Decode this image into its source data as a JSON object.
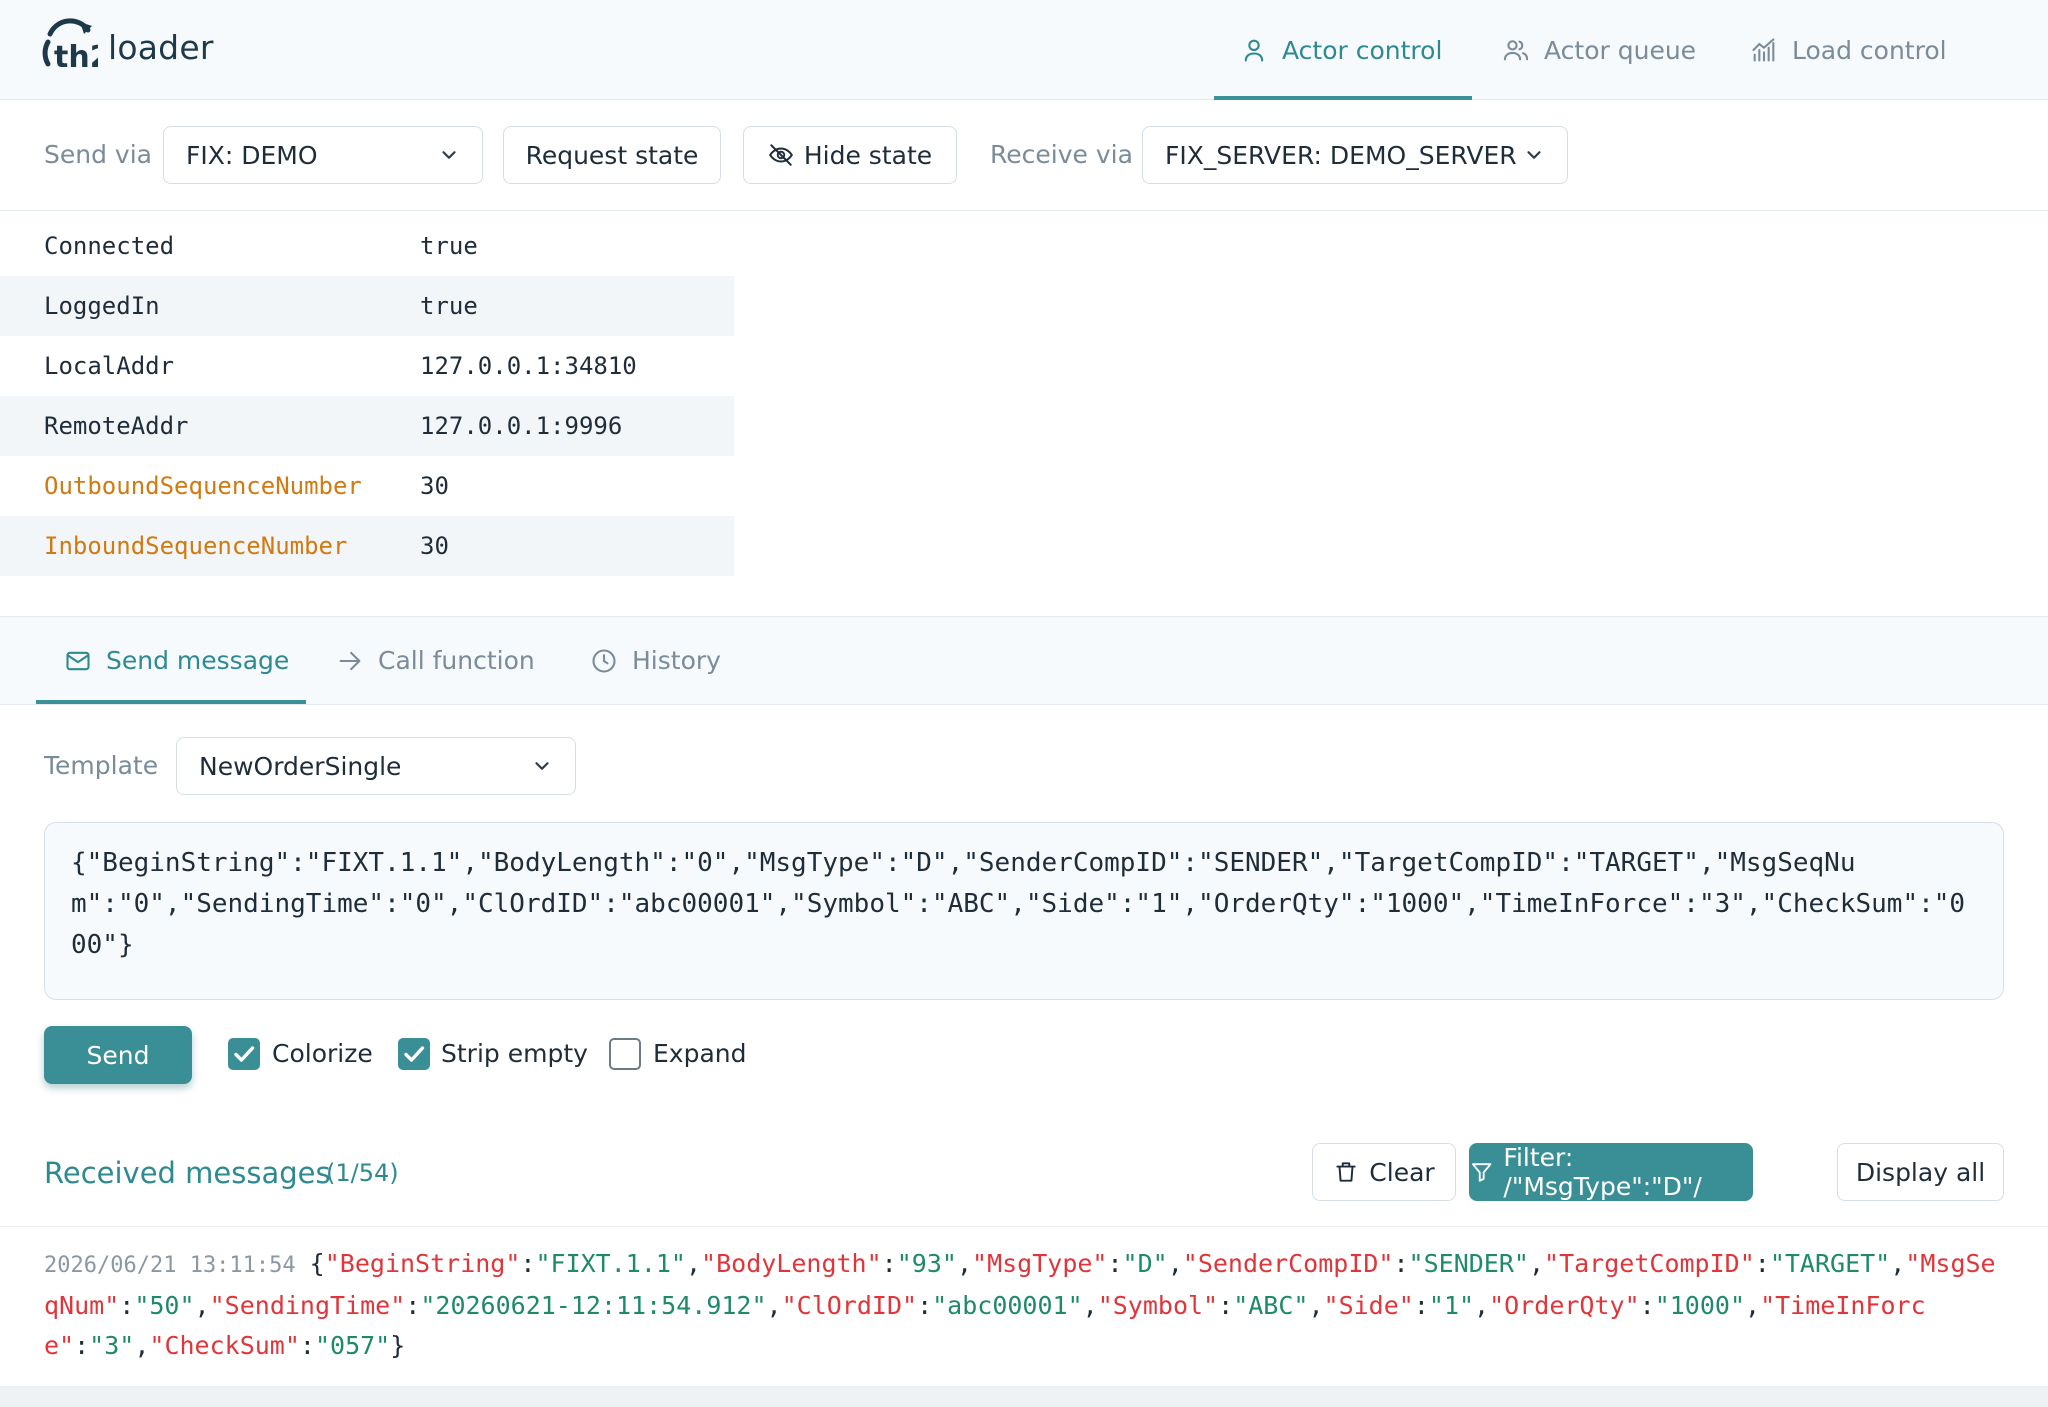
{
  "app": {
    "logo_text_bold": "th2",
    "logo_text": "loader"
  },
  "nav": [
    {
      "label": "Actor control",
      "icon": "user-icon",
      "active": true
    },
    {
      "label": "Actor queue",
      "icon": "users-icon",
      "active": false
    },
    {
      "label": "Load control",
      "icon": "chart-icon",
      "active": false
    }
  ],
  "toolbar": {
    "send_via_label": "Send via",
    "send_via_value": "FIX: DEMO",
    "request_state_label": "Request state",
    "hide_state_label": "Hide state",
    "receive_via_label": "Receive via",
    "receive_via_value": "FIX_SERVER: DEMO_SERVER"
  },
  "state": [
    {
      "key": "Connected",
      "value": "true",
      "highlight": false
    },
    {
      "key": "LoggedIn",
      "value": "true",
      "highlight": false
    },
    {
      "key": "LocalAddr",
      "value": "127.0.0.1:34810",
      "highlight": false
    },
    {
      "key": "RemoteAddr",
      "value": "127.0.0.1:9996",
      "highlight": false
    },
    {
      "key": "OutboundSequenceNumber",
      "value": "30",
      "highlight": true
    },
    {
      "key": "InboundSequenceNumber",
      "value": "30",
      "highlight": true
    }
  ],
  "tabs": [
    {
      "label": "Send message",
      "icon": "mail-icon",
      "active": true
    },
    {
      "label": "Call function",
      "icon": "arrow-right-icon",
      "active": false
    },
    {
      "label": "History",
      "icon": "clock-icon",
      "active": false
    }
  ],
  "template": {
    "label": "Template",
    "value": "NewOrderSingle",
    "body": "{\"BeginString\":\"FIXT.1.1\",\"BodyLength\":\"0\",\"MsgType\":\"D\",\"SenderCompID\":\"SENDER\",\"TargetCompID\":\"TARGET\",\"MsgSeqNum\":\"0\",\"SendingTime\":\"0\",\"ClOrdID\":\"abc00001\",\"Symbol\":\"ABC\",\"Side\":\"1\",\"OrderQty\":\"1000\",\"TimeInForce\":\"3\",\"CheckSum\":\"000\"}"
  },
  "send": {
    "button_label": "Send",
    "options": [
      {
        "label": "Colorize",
        "checked": true
      },
      {
        "label": "Strip empty",
        "checked": true
      },
      {
        "label": "Expand",
        "checked": false
      }
    ]
  },
  "received": {
    "title": "Received messages",
    "count": "(1/54)",
    "clear_label": "Clear",
    "filter_label": "Filter: /\"MsgType\":\"D\"/",
    "display_all_label": "Display all",
    "messages": [
      {
        "timestamp": "2026/06/21 13:11:54",
        "fields": [
          {
            "k": "BeginString",
            "v": "FIXT.1.1"
          },
          {
            "k": "BodyLength",
            "v": "93"
          },
          {
            "k": "MsgType",
            "v": "D"
          },
          {
            "k": "SenderCompID",
            "v": "SENDER"
          },
          {
            "k": "TargetCompID",
            "v": "TARGET"
          },
          {
            "k": "MsgSeqNum",
            "v": "50"
          },
          {
            "k": "SendingTime",
            "v": "20260621-12:11:54.912"
          },
          {
            "k": "ClOrdID",
            "v": "abc00001"
          },
          {
            "k": "Symbol",
            "v": "ABC"
          },
          {
            "k": "Side",
            "v": "1"
          },
          {
            "k": "OrderQty",
            "v": "1000"
          },
          {
            "k": "TimeInForce",
            "v": "3"
          },
          {
            "k": "CheckSum",
            "v": "057"
          }
        ]
      }
    ]
  },
  "colors": {
    "accent": "#3a8f96",
    "warn_key": "#d07a12",
    "json_key": "#e0353b",
    "json_value": "#1f8a6a"
  }
}
